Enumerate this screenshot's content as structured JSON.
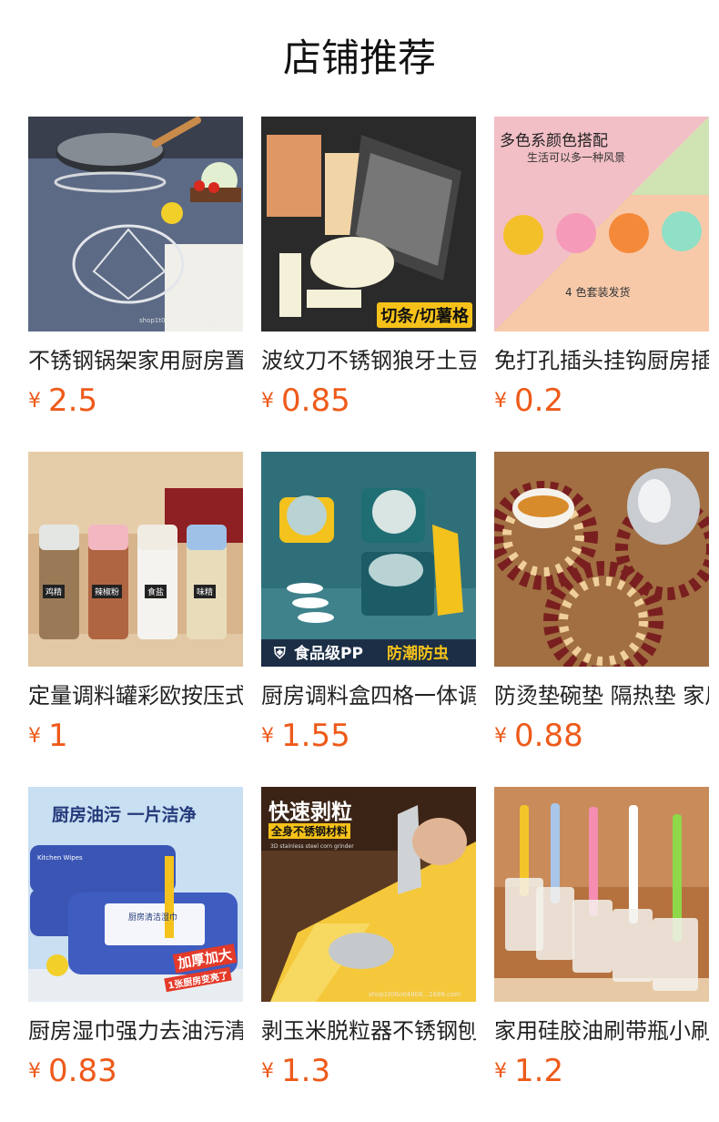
{
  "title": "店铺推荐",
  "currency_symbol": "¥",
  "products": [
    {
      "name": "不锈钢锅架家用厨房置物架",
      "price": "2.5",
      "image_text": [
        "shop1t06o04808...1688.com"
      ]
    },
    {
      "name": "波纹刀不锈钢狼牙土豆切条",
      "price": "0.85",
      "image_text": [
        "切条/切薯格"
      ]
    },
    {
      "name": "免打孔插头挂钩厨房插座收纳",
      "price": "0.2",
      "image_text": [
        "多色系颜色搭配",
        "生活可以多一种风景",
        "4 色套装发货"
      ]
    },
    {
      "name": "定量调料罐彩欧按压式玻璃",
      "price": "1",
      "image_text": [
        "鸡精",
        "辣椒粉",
        "食盐",
        "味精"
      ]
    },
    {
      "name": "厨房调料盒四格一体调味罐",
      "price": "1.55",
      "image_text": [
        "食品级PP",
        "防潮防虫"
      ]
    },
    {
      "name": "防烫垫碗垫 隔热垫 家用",
      "price": "0.88",
      "image_text": []
    },
    {
      "name": "厨房湿巾强力去油污清洁",
      "price": "0.83",
      "image_text": [
        "厨房油污 一片洁净",
        "Kitchen Wipes",
        "厨房清洁湿巾",
        "加厚加大",
        "1张厨房变亮了"
      ]
    },
    {
      "name": "剥玉米脱粒器不锈钢刨玉米",
      "price": "1.3",
      "image_text": [
        "快速剥粒",
        "全身不锈钢材料",
        "3D stainless steel corn grinder",
        "shop1t06o04808...1688.com"
      ]
    },
    {
      "name": "家用硅胶油刷带瓶小刷子",
      "price": "1.2",
      "image_text": []
    }
  ],
  "colors": {
    "price": "#ee5a1a",
    "title": "#111111",
    "name": "#222222"
  }
}
